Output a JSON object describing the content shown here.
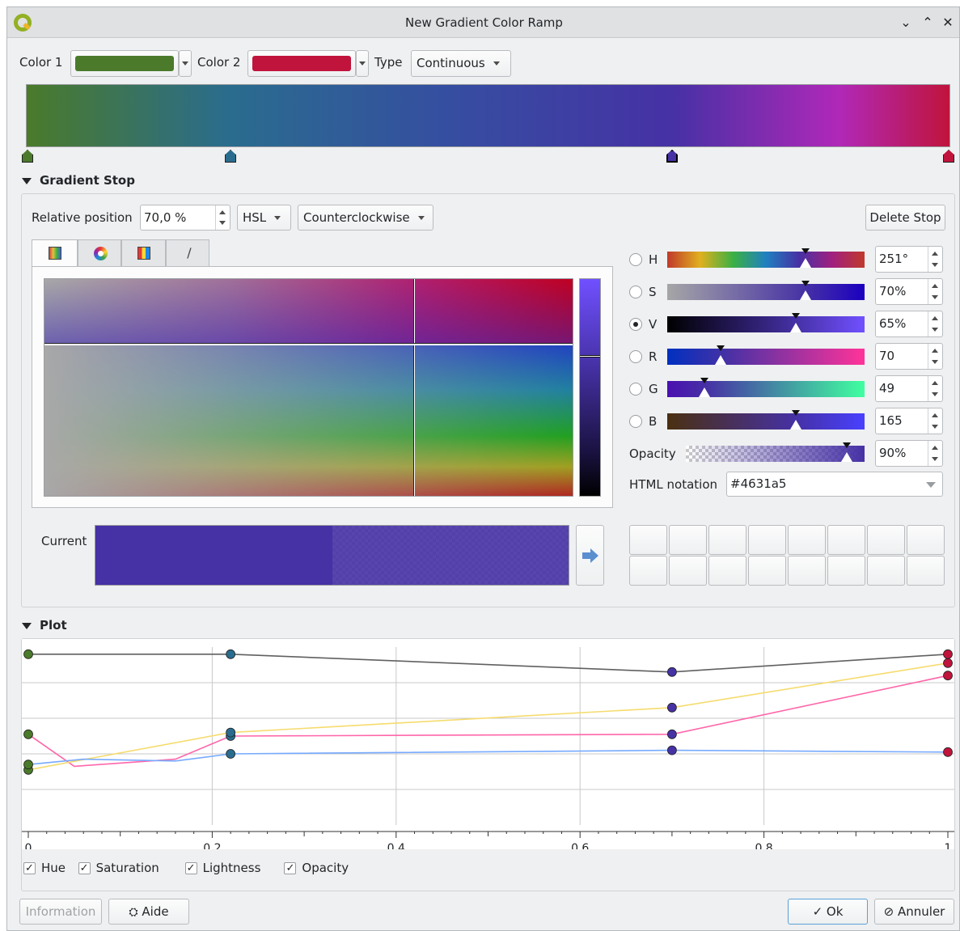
{
  "window": {
    "title": "New Gradient Color Ramp",
    "controls": [
      "minimize",
      "maximize",
      "close"
    ]
  },
  "top": {
    "color1_label": "Color 1",
    "color1_hex": "#4a7a2a",
    "color2_label": "Color 2",
    "color2_hex": "#c0143c",
    "type_label": "Type",
    "type_value": "Continuous"
  },
  "ramp": {
    "stops": [
      {
        "position": 0.0,
        "color": "#4a7a2a"
      },
      {
        "position": 0.22,
        "color": "#2a6c8e"
      },
      {
        "position": 0.7,
        "color": "#4631a5"
      },
      {
        "position": 1.0,
        "color": "#c0143c"
      }
    ],
    "selected_stop": 2
  },
  "gradient_stop": {
    "section_title": "Gradient Stop",
    "relative_position_label": "Relative position",
    "relative_position_value": "70,0 %",
    "color_spec": "HSL",
    "direction": "Counterclockwise",
    "delete_stop_label": "Delete Stop",
    "picker_tabs": [
      {
        "name": "color-ramp-tab-icon",
        "selected": true
      },
      {
        "name": "color-wheel-tab-icon",
        "selected": false
      },
      {
        "name": "swatches-tab-icon",
        "selected": false
      },
      {
        "name": "eyedropper-tab-icon",
        "selected": false
      }
    ],
    "channels": [
      {
        "key": "H",
        "value": "251°",
        "level": 0.7,
        "checked": false
      },
      {
        "key": "S",
        "value": "70%",
        "level": 0.7,
        "checked": false
      },
      {
        "key": "V",
        "value": "65%",
        "level": 0.65,
        "checked": true
      },
      {
        "key": "R",
        "value": "70",
        "level": 0.27,
        "checked": false
      },
      {
        "key": "G",
        "value": "49",
        "level": 0.19,
        "checked": false
      },
      {
        "key": "B",
        "value": "165",
        "level": 0.65,
        "checked": false
      }
    ],
    "opacity_label": "Opacity",
    "opacity_value": "90%",
    "opacity_level": 0.9,
    "html_notation_label": "HTML notation",
    "html_notation_value": "#4631a5",
    "current_label": "Current",
    "current_color": "#4631a5"
  },
  "plot": {
    "section_title": "Plot",
    "x_ticks": [
      "0",
      "0,2",
      "0,4",
      "0,6",
      "0,8",
      "1"
    ],
    "checkboxes": [
      {
        "label": "Hue",
        "checked": true
      },
      {
        "label": "Saturation",
        "checked": true
      },
      {
        "label": "Lightness",
        "checked": true
      },
      {
        "label": "Opacity",
        "checked": true
      }
    ]
  },
  "chart_data": {
    "type": "line",
    "title": "",
    "xlabel": "",
    "ylabel": "",
    "xlim": [
      0,
      1
    ],
    "ylim": [
      0,
      1
    ],
    "x_tick_labels": [
      "0",
      "0,2",
      "0,4",
      "0,6",
      "0,8",
      "1"
    ],
    "series": [
      {
        "name": "Hue",
        "color": "#ff66aa",
        "x": [
          0,
          0.05,
          0.16,
          0.22,
          0.7,
          1.0
        ],
        "y": [
          0.51,
          0.33,
          0.37,
          0.5,
          0.51,
          0.84
        ]
      },
      {
        "name": "Saturation",
        "color": "#f5dc6e",
        "x": [
          0,
          0.22,
          0.7,
          1.0
        ],
        "y": [
          0.31,
          0.52,
          0.66,
          0.91
        ]
      },
      {
        "name": "Lightness",
        "color": "#77aaff",
        "x": [
          0,
          0.06,
          0.16,
          0.22,
          0.7,
          1.0
        ],
        "y": [
          0.34,
          0.37,
          0.36,
          0.4,
          0.42,
          0.41
        ]
      },
      {
        "name": "Opacity",
        "color": "#606060",
        "x": [
          0,
          0.22,
          0.7,
          1.0
        ],
        "y": [
          0.96,
          0.96,
          0.86,
          0.96
        ]
      }
    ],
    "stop_markers": [
      {
        "x": 0,
        "color": "#4a7a2a"
      },
      {
        "x": 0.22,
        "color": "#2a6c8e"
      },
      {
        "x": 0.7,
        "color": "#4631a5"
      },
      {
        "x": 1.0,
        "color": "#c0143c"
      }
    ],
    "grid": true
  },
  "footer": {
    "information_label": "Information",
    "help_label": "Aide",
    "ok_label": "Ok",
    "cancel_label": "Annuler"
  }
}
